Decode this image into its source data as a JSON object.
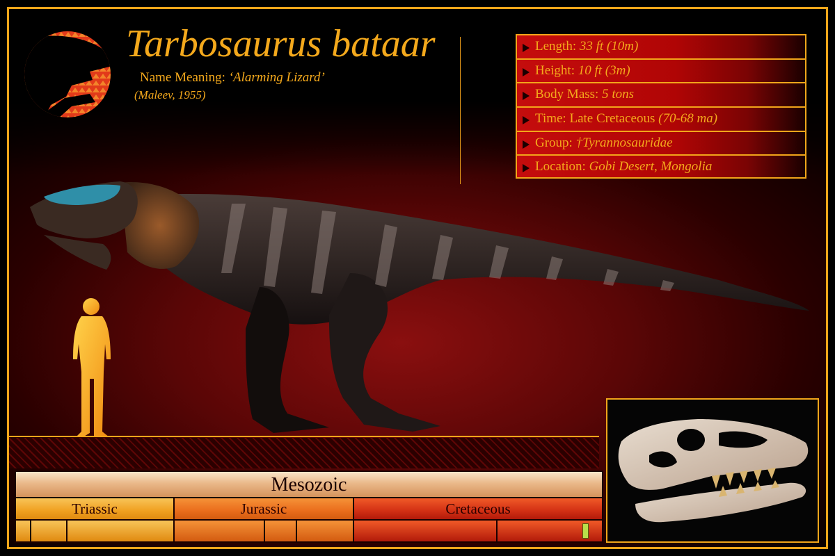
{
  "header": {
    "title": "Tarbosaurus bataar",
    "meaning_label": "Name Meaning: ",
    "meaning_value": "‘Alarming Lizard’",
    "author": "(Maleev, 1955)"
  },
  "info": [
    {
      "label": "Length: ",
      "value": "33 ft (10m)"
    },
    {
      "label": "Height: ",
      "value": "10 ft (3m)"
    },
    {
      "label": "Body Mass: ",
      "value": "5 tons"
    },
    {
      "label": "Time: Late Cretaceous ",
      "value": "(70-68 ma)"
    },
    {
      "label": "Group: ",
      "value": "†Tyrannosauridae"
    },
    {
      "label": "Location: ",
      "value": "Gobi Desert, Mongolia"
    }
  ],
  "timeline": {
    "era": "Mesozoic",
    "periods": [
      "Triassic",
      "Jurassic",
      "Cretaceous"
    ]
  },
  "colors": {
    "accent": "#f4a91c",
    "background_red": "#8a0f0f",
    "info_red": "#c50d0d",
    "marker": "#b8e04a"
  },
  "icons": {
    "logo": "tyrannosaur-head-logo-icon",
    "arrow": "triangle-arrow-icon"
  }
}
